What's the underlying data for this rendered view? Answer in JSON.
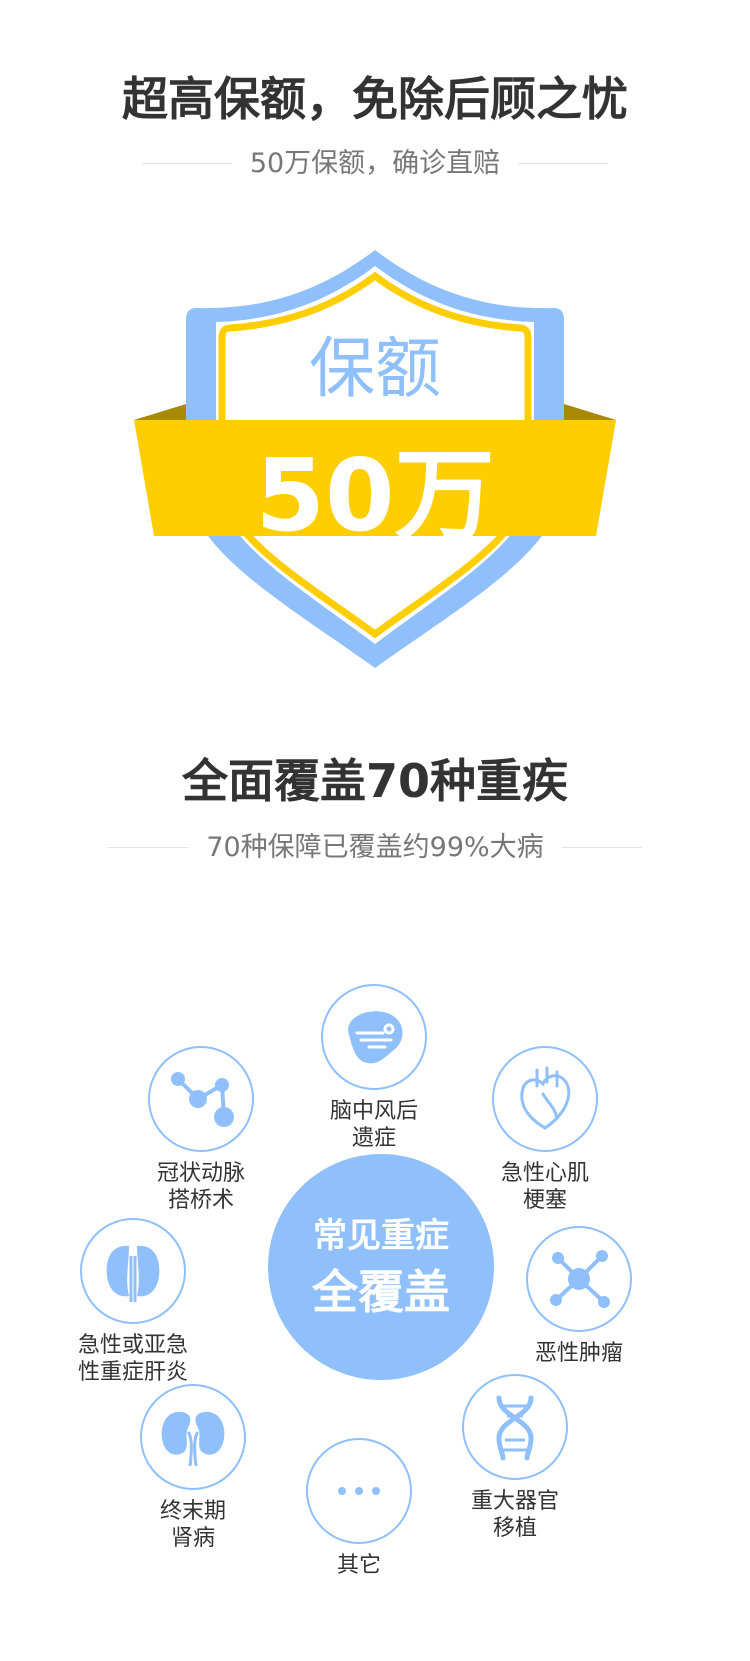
{
  "section1": {
    "title": "超高保额，免除后顾之忧",
    "subtitle": "50万保额，确诊直赔",
    "shield": {
      "top_label": "保额",
      "amount": "50万"
    }
  },
  "section2": {
    "title": "全面覆盖70种重疾",
    "subtitle": "70种保障已覆盖约99%大病",
    "center": {
      "line1": "常见重症",
      "line2": "全覆盖"
    },
    "diseases": [
      {
        "label": "脑中风后\n遗症",
        "icon": "brain-icon"
      },
      {
        "label": "冠状动脉\n搭桥术",
        "icon": "molecule-chain-icon"
      },
      {
        "label": "急性心肌\n梗塞",
        "icon": "heart-icon"
      },
      {
        "label": "急性或亚急\n性重症肝炎",
        "icon": "liver-icon"
      },
      {
        "label": "恶性肿瘤",
        "icon": "tumor-network-icon"
      },
      {
        "label": "终末期\n肾病",
        "icon": "kidney-icon"
      },
      {
        "label": "重大器官\n移植",
        "icon": "dna-icon"
      },
      {
        "label": "其它",
        "icon": "more-dots-icon"
      }
    ]
  },
  "colors": {
    "accent_blue": "#8fc0fb",
    "accent_yellow": "#fece00",
    "ribbon_dark": "#a88a00",
    "title_text": "#333333",
    "subtitle_text": "#777777"
  }
}
